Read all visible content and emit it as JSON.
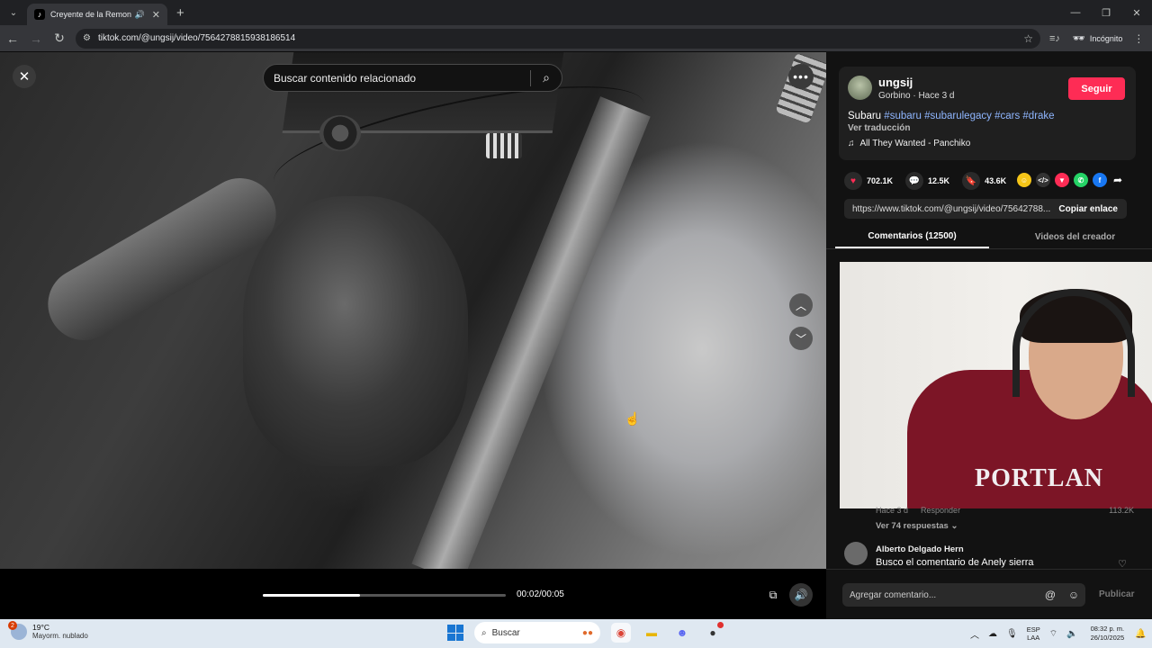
{
  "browser": {
    "tab_title": "Creyente de la Remontadá",
    "url": "tiktok.com/@ungsij/video/7564278815938186514",
    "incognito_label": "Incógnito"
  },
  "video": {
    "search_placeholder": "Buscar contenido relacionado",
    "time": "00:02/00:05",
    "progress": 0.4
  },
  "creator": {
    "username": "ungsij",
    "meta": "Gorbino · Hace 3 d",
    "follow_label": "Seguir",
    "caption_text": "Subaru",
    "hashtags": [
      "#subaru",
      "#subarulegacy",
      "#cars",
      "#drake"
    ],
    "translate_label": "Ver traducción",
    "music": "All They Wanted - Panchiko"
  },
  "stats": {
    "likes": "702.1K",
    "comments": "12.5K",
    "saves": "43.6K"
  },
  "share": {
    "link": "https://www.tiktok.com/@ungsij/video/75642788...",
    "copy_label": "Copiar enlace",
    "icons": [
      {
        "name": "friends",
        "color": "#f5c518",
        "glyph": "☺"
      },
      {
        "name": "embed",
        "color": "#333333",
        "glyph": "</>"
      },
      {
        "name": "send",
        "color": "#fe2c55",
        "glyph": "▼"
      },
      {
        "name": "whatsapp",
        "color": "#25d366",
        "glyph": "✆"
      },
      {
        "name": "facebook",
        "color": "#1877f2",
        "glyph": "f"
      }
    ]
  },
  "tabs": {
    "comments": "Comentarios (12500)",
    "creator_videos": "Videos del creador"
  },
  "webcam": {
    "shirt_text": "PORTLAN"
  },
  "comments": {
    "c1_time": "Hace 3 d",
    "c1_reply": "Responder",
    "c1_likes": "113.2K",
    "view_replies": "Ver 74 respuestas",
    "c2_name": "Alberto Delgado Hern",
    "c2_text": "Busco el comentario de Anely sierra",
    "input_placeholder": "Agregar comentario...",
    "publish_label": "Publicar"
  },
  "taskbar": {
    "weather_badge": "2",
    "temperature": "19°C",
    "weather_desc": "Mayorm. nublado",
    "search_label": "Buscar",
    "lang_top": "ESP",
    "lang_bottom": "LAA",
    "time": "08:32 p. m.",
    "date": "26/10/2025"
  }
}
